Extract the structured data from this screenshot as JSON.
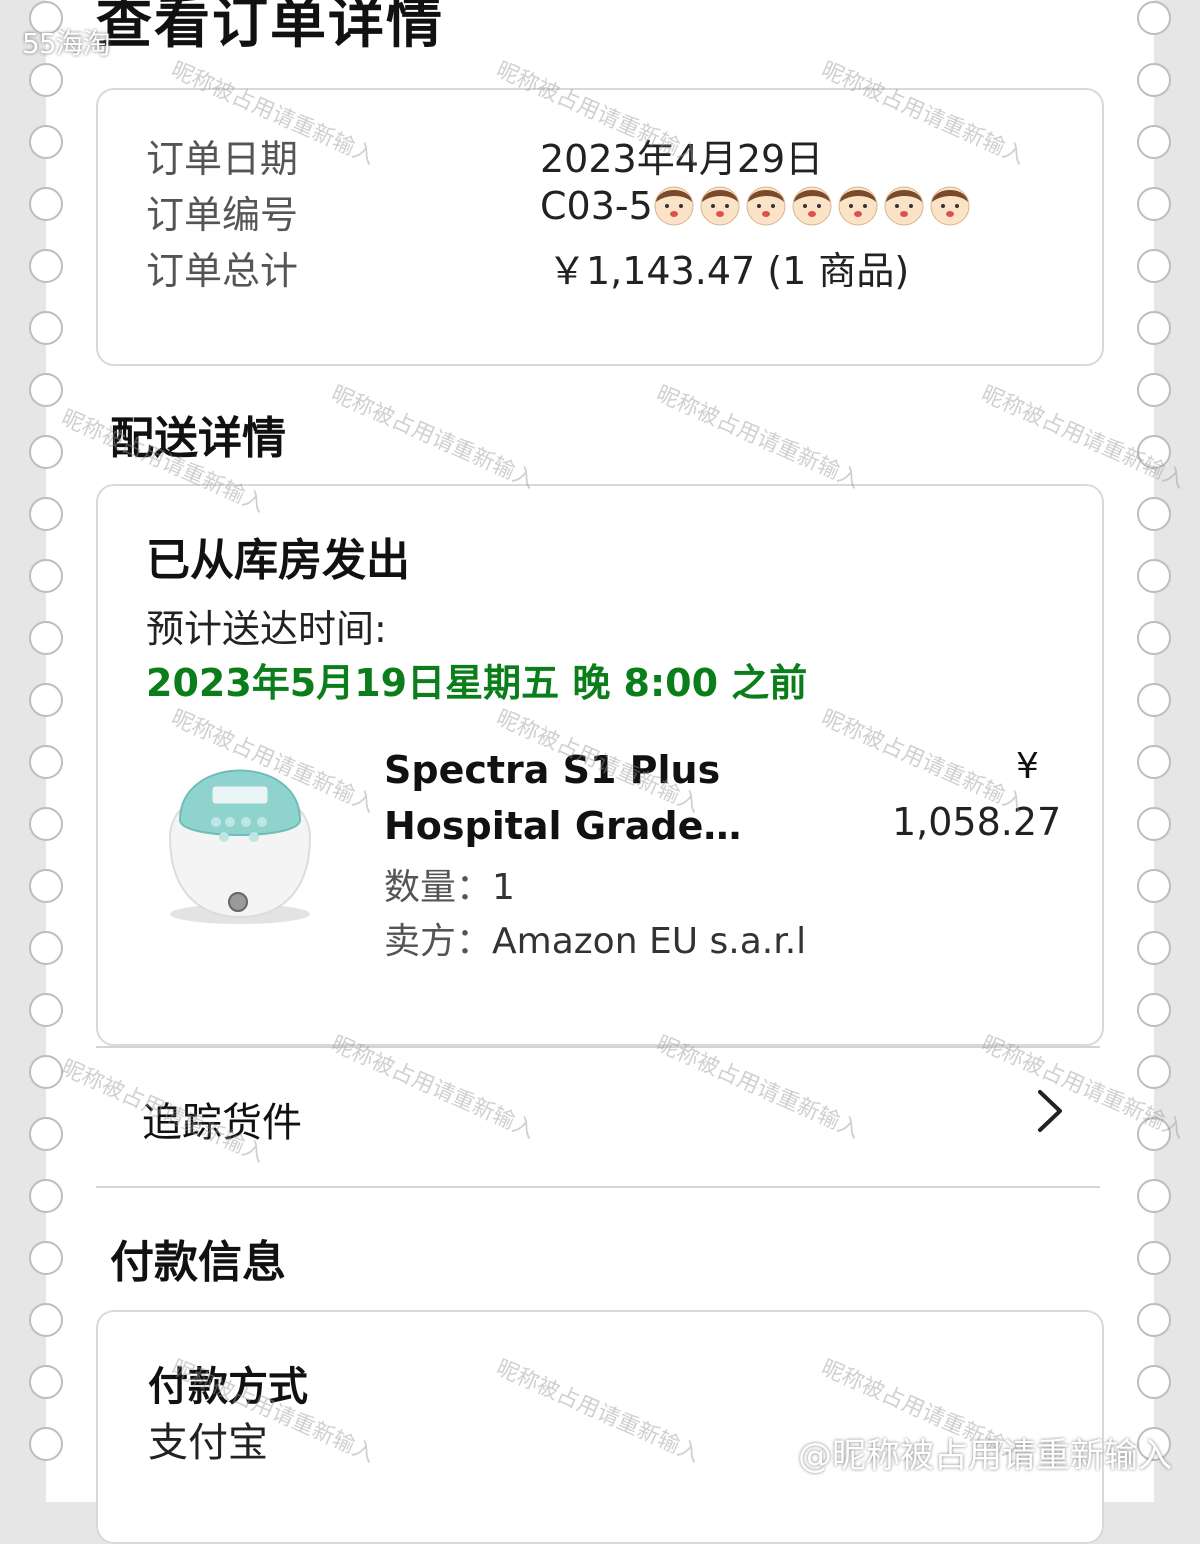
{
  "watermarks": {
    "brand": "55海淘",
    "diagonal": "昵称被占用请重新输入",
    "footer": "@昵称被占用请重新输入"
  },
  "header": {
    "title": "查看订单详情"
  },
  "order_summary": {
    "rows": [
      {
        "label": "订单日期",
        "value": "2023年4月29日"
      },
      {
        "label": "订单编号",
        "value": "C03-5"
      },
      {
        "label": "订单总计",
        "value": "￥1,143.47 (1 商品)"
      }
    ],
    "order_number_redacted": true
  },
  "delivery": {
    "section_title": "配送详情",
    "status": "已从库房发出",
    "eta_label": "预计送达时间:",
    "eta_value": "2023年5月19日星期五 晚 8:00 之前",
    "eta_color": "#0b7d1a",
    "item": {
      "name_line1": "Spectra S1 Plus",
      "name_line2": "Hospital Grade…",
      "price_currency": "¥",
      "price_value": "1,058.27",
      "qty_label": "数量：",
      "qty_value": "1",
      "seller_label": "卖方：",
      "seller_value": "Amazon EU s.a.r.l"
    },
    "track_label": "追踪货件"
  },
  "payment": {
    "section_title": "付款信息",
    "method_label": "付款方式",
    "method_value": "支付宝"
  },
  "icons": {
    "chevron": "chevron-right-icon",
    "redaction": "cartoon-face-sticker"
  }
}
